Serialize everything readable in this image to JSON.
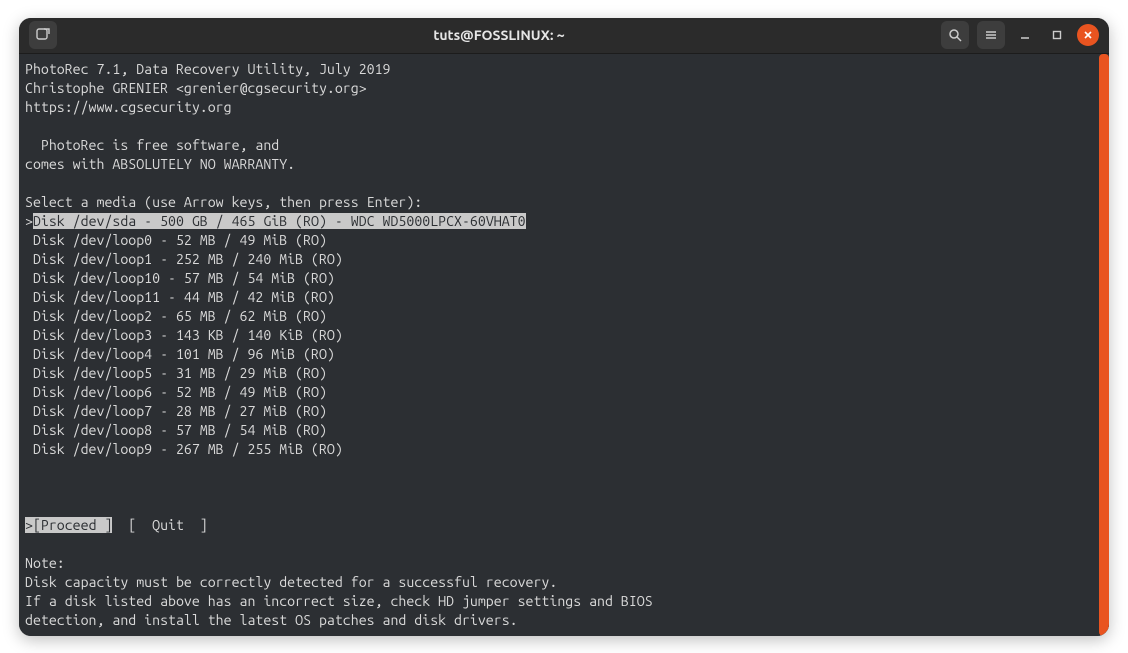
{
  "window": {
    "title": "tuts@FOSSLINUX: ~"
  },
  "app": {
    "header": "PhotoRec 7.1, Data Recovery Utility, July 2019",
    "author": "Christophe GRENIER <grenier@cgsecurity.org>",
    "url": "https://www.cgsecurity.org",
    "notice_line1": "  PhotoRec is free software, and",
    "notice_line2": "comes with ABSOLUTELY NO WARRANTY.",
    "select_prompt": "Select a media (use Arrow keys, then press Enter):"
  },
  "disks": [
    {
      "selected": true,
      "text": "Disk /dev/sda - 500 GB / 465 GiB (RO) - WDC WD5000LPCX-60VHAT0"
    },
    {
      "selected": false,
      "text": " Disk /dev/loop0 - 52 MB / 49 MiB (RO)"
    },
    {
      "selected": false,
      "text": " Disk /dev/loop1 - 252 MB / 240 MiB (RO)"
    },
    {
      "selected": false,
      "text": " Disk /dev/loop10 - 57 MB / 54 MiB (RO)"
    },
    {
      "selected": false,
      "text": " Disk /dev/loop11 - 44 MB / 42 MiB (RO)"
    },
    {
      "selected": false,
      "text": " Disk /dev/loop2 - 65 MB / 62 MiB (RO)"
    },
    {
      "selected": false,
      "text": " Disk /dev/loop3 - 143 KB / 140 KiB (RO)"
    },
    {
      "selected": false,
      "text": " Disk /dev/loop4 - 101 MB / 96 MiB (RO)"
    },
    {
      "selected": false,
      "text": " Disk /dev/loop5 - 31 MB / 29 MiB (RO)"
    },
    {
      "selected": false,
      "text": " Disk /dev/loop6 - 52 MB / 49 MiB (RO)"
    },
    {
      "selected": false,
      "text": " Disk /dev/loop7 - 28 MB / 27 MiB (RO)"
    },
    {
      "selected": false,
      "text": " Disk /dev/loop8 - 57 MB / 54 MiB (RO)"
    },
    {
      "selected": false,
      "text": " Disk /dev/loop9 - 267 MB / 255 MiB (RO)"
    }
  ],
  "menu": {
    "cursor": ">",
    "proceed": "[Proceed ]",
    "quit": "[  Quit  ]"
  },
  "note": {
    "heading": "Note:",
    "line1": "Disk capacity must be correctly detected for a successful recovery.",
    "line2": "If a disk listed above has an incorrect size, check HD jumper settings and BIOS",
    "line3": "detection, and install the latest OS patches and disk drivers."
  }
}
